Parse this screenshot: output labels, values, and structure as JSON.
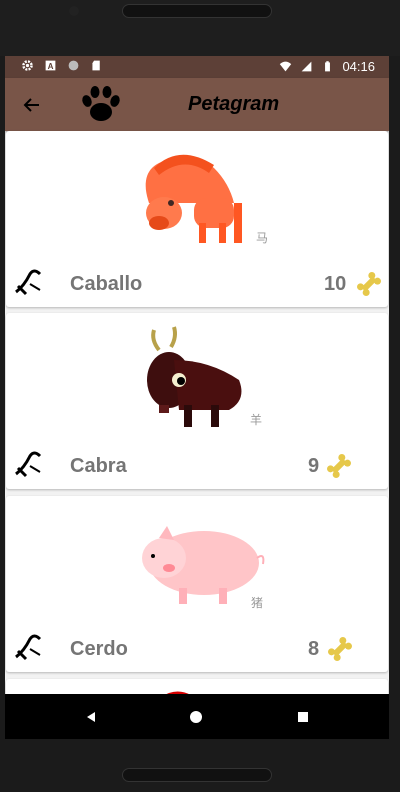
{
  "status_bar": {
    "time": "04:16",
    "icons": [
      "gear-icon",
      "a-icon",
      "circle-icon",
      "sd-card-icon",
      "wifi-icon",
      "signal-icon",
      "battery-icon"
    ]
  },
  "app_bar": {
    "title": "Petagram",
    "back_icon": "arrow-left-icon",
    "logo_icon": "paw-icon"
  },
  "pets": [
    {
      "name": "Caballo",
      "count": "10",
      "chinese_label": "马",
      "image": "horse"
    },
    {
      "name": "Cabra",
      "count": "9",
      "chinese_label": "羊",
      "image": "goat"
    },
    {
      "name": "Cerdo",
      "count": "8",
      "chinese_label": "猪",
      "image": "pig"
    }
  ],
  "nav_bar": {
    "buttons": [
      "back-triangle-icon",
      "home-circle-icon",
      "recents-square-icon"
    ]
  },
  "colors": {
    "primary": "#795548",
    "primary_dark": "#5d4037",
    "text": "#757575"
  }
}
